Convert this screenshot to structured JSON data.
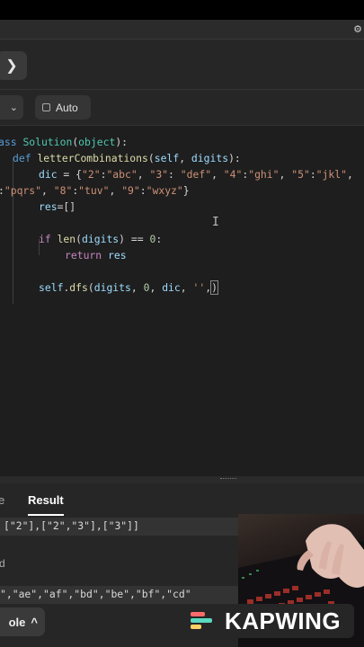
{
  "nav": {
    "next_glyph": "❯"
  },
  "editor_toolbar": {
    "language_chevron": "⌄",
    "auto_label": "Auto"
  },
  "code": {
    "line1": {
      "a": "ass ",
      "b": "Solution",
      "c": "(",
      "d": "object",
      "e": "):"
    },
    "line2": {
      "a": "def ",
      "b": "letterCombinations",
      "c": "(",
      "d": "self",
      "e": ", ",
      "f": "digits",
      "g": "):"
    },
    "line3": {
      "a": "dic",
      "b": " = {",
      "c": "\"2\"",
      "d": ":",
      "e": "\"abc\"",
      "f": ", ",
      "g": "\"3\"",
      "h": ": ",
      "i": "\"def\"",
      "j": ", ",
      "k": "\"4\"",
      "l": ":",
      "m": "\"ghi\"",
      "n": ", ",
      "o": "\"5\"",
      "p": ":",
      "q": "\"jkl\"",
      "r": ","
    },
    "line4": {
      "a": ":",
      "b": "\"pqrs\"",
      "c": ", ",
      "d": "\"8\"",
      "e": ":",
      "f": "\"tuv\"",
      "g": ", ",
      "h": "\"9\"",
      "i": ":",
      "j": "\"wxyz\"",
      "k": "}"
    },
    "line5": {
      "a": "res",
      "b": "=[]"
    },
    "line6": {
      "a": "if ",
      "b": "len",
      "c": "(",
      "d": "digits",
      "e": ") == ",
      "f": "0",
      "g": ":"
    },
    "line7": {
      "a": "return ",
      "b": "res"
    },
    "line8": {
      "a": "self",
      "b": ".",
      "c": "dfs",
      "d": "(",
      "e": "digits",
      "f": ", ",
      "g": "0",
      "h": ", ",
      "i": "dic",
      "j": ", ",
      "k": "''",
      "l": ",",
      "m": ")"
    }
  },
  "panel": {
    "tab_partial": "e",
    "tab_result": "Result",
    "result_line": "[\"2\"],[\"2\",\"3\"],[\"3\"]]",
    "label_partial": "d",
    "output_line": "\",\"ae\",\"af\",\"bd\",\"be\",\"bf\",\"cd\"",
    "console_label": "ole",
    "console_chevron": "^"
  },
  "watermark": {
    "text": "KAPWING"
  },
  "colors": {
    "keyword": "#569cd6",
    "class": "#4ec9b0",
    "function": "#dcdcaa",
    "string": "#ce9178",
    "number": "#b5cea8",
    "control": "#c586c0"
  }
}
